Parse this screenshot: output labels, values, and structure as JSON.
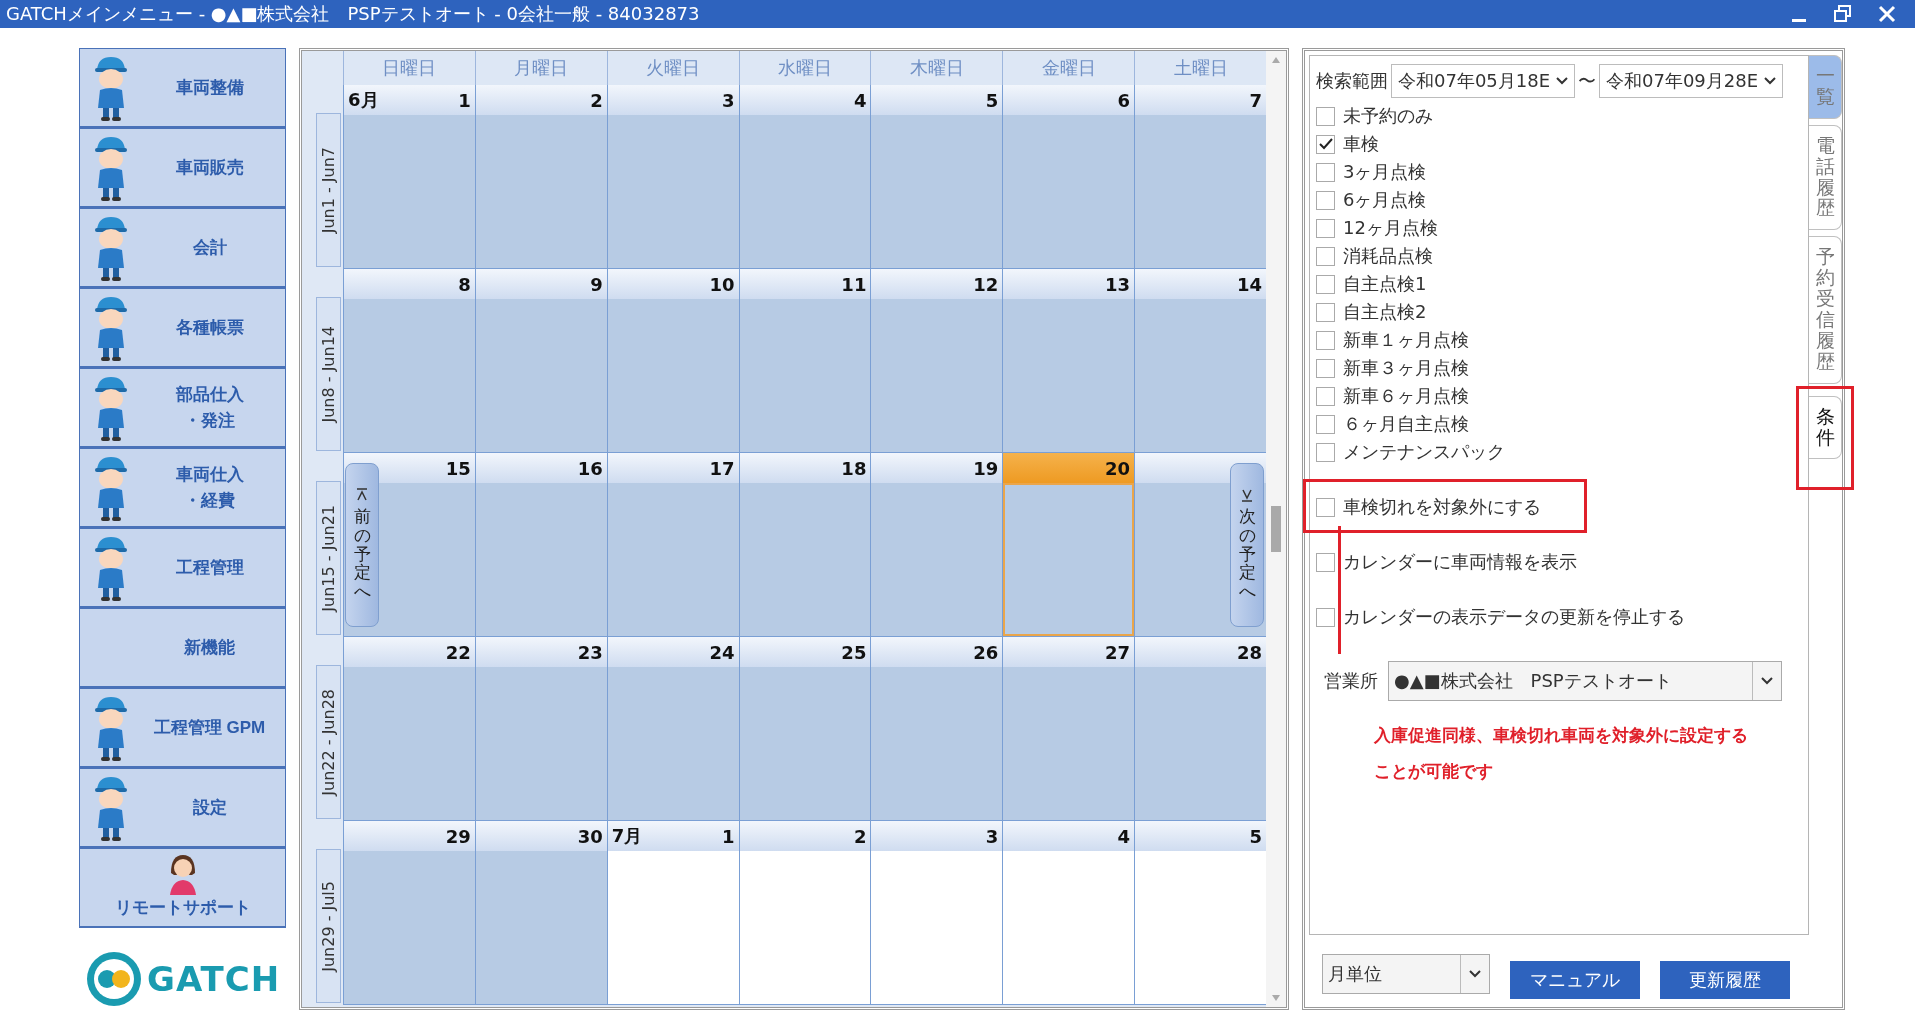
{
  "window": {
    "title": "GATCHメインメニュー - ●▲■株式会社　PSPテストオート - 0会社一般 - 84032873"
  },
  "sidebar": {
    "items": [
      {
        "lines": [
          "車両整備"
        ],
        "kind": "mechanic"
      },
      {
        "lines": [
          "車両販売"
        ],
        "kind": "mechanic"
      },
      {
        "lines": [
          "会計"
        ],
        "kind": "mechanic"
      },
      {
        "lines": [
          "各種帳票"
        ],
        "kind": "mechanic"
      },
      {
        "lines": [
          "部品仕入",
          "・発注"
        ],
        "kind": "mechanic"
      },
      {
        "lines": [
          "車両仕入",
          "・経費"
        ],
        "kind": "mechanic"
      },
      {
        "lines": [
          "工程管理"
        ],
        "kind": "mechanic"
      },
      {
        "lines": [
          "新機能"
        ],
        "kind": "plain"
      },
      {
        "lines": [
          "工程管理 GPM"
        ],
        "kind": "mechanic"
      },
      {
        "lines": [
          "設定"
        ],
        "kind": "mechanic"
      },
      {
        "lines": [
          "リモートサポート"
        ],
        "kind": "support"
      }
    ],
    "logo": "GATCH"
  },
  "calendar": {
    "weekdays": [
      "日曜日",
      "月曜日",
      "火曜日",
      "水曜日",
      "木曜日",
      "金曜日",
      "土曜日"
    ],
    "weeks": [
      {
        "label": "Jun1 - Jun7",
        "days": [
          {
            "day": "1",
            "month": "6月",
            "in_month": true,
            "today": false
          },
          {
            "day": "2",
            "in_month": true,
            "today": false
          },
          {
            "day": "3",
            "in_month": true,
            "today": false
          },
          {
            "day": "4",
            "in_month": true,
            "today": false
          },
          {
            "day": "5",
            "in_month": true,
            "today": false
          },
          {
            "day": "6",
            "in_month": true,
            "today": false
          },
          {
            "day": "7",
            "in_month": true,
            "today": false
          }
        ]
      },
      {
        "label": "Jun8 - Jun14",
        "days": [
          {
            "day": "8",
            "in_month": true,
            "today": false
          },
          {
            "day": "9",
            "in_month": true,
            "today": false
          },
          {
            "day": "10",
            "in_month": true,
            "today": false
          },
          {
            "day": "11",
            "in_month": true,
            "today": false
          },
          {
            "day": "12",
            "in_month": true,
            "today": false
          },
          {
            "day": "13",
            "in_month": true,
            "today": false
          },
          {
            "day": "14",
            "in_month": true,
            "today": false
          }
        ]
      },
      {
        "label": "Jun15 - Jun21",
        "prev_button": "前の予定へ",
        "next_button": "次の予定へ",
        "days": [
          {
            "day": "15",
            "in_month": true,
            "today": false
          },
          {
            "day": "16",
            "in_month": true,
            "today": false
          },
          {
            "day": "17",
            "in_month": true,
            "today": false
          },
          {
            "day": "18",
            "in_month": true,
            "today": false
          },
          {
            "day": "19",
            "in_month": true,
            "today": false
          },
          {
            "day": "20",
            "in_month": true,
            "today": true
          },
          {
            "in_month": true,
            "today": false
          }
        ]
      },
      {
        "label": "Jun22 - Jun28",
        "days": [
          {
            "day": "22",
            "in_month": true,
            "today": false
          },
          {
            "day": "23",
            "in_month": true,
            "today": false
          },
          {
            "day": "24",
            "in_month": true,
            "today": false
          },
          {
            "day": "25",
            "in_month": true,
            "today": false
          },
          {
            "day": "26",
            "in_month": true,
            "today": false
          },
          {
            "day": "27",
            "in_month": true,
            "today": false
          },
          {
            "day": "28",
            "in_month": true,
            "today": false
          }
        ]
      },
      {
        "label": "Jun29 - Jul5",
        "days": [
          {
            "day": "29",
            "in_month": true,
            "today": false
          },
          {
            "day": "30",
            "in_month": true,
            "today": false
          },
          {
            "day": "1",
            "month": "7月",
            "in_month": false,
            "today": false
          },
          {
            "day": "2",
            "in_month": false,
            "today": false
          },
          {
            "day": "3",
            "in_month": false,
            "today": false
          },
          {
            "day": "4",
            "in_month": false,
            "today": false
          },
          {
            "day": "5",
            "in_month": false,
            "today": false
          }
        ]
      }
    ]
  },
  "conditions": {
    "search": {
      "label": "検索範囲",
      "from": "令和07年05月18E",
      "separator": "〜",
      "to": "令和07年09月28E"
    },
    "filters": [
      {
        "label": "未予約のみ",
        "checked": false
      },
      {
        "label": "車検",
        "checked": true
      },
      {
        "label": "3ヶ月点検",
        "checked": false
      },
      {
        "label": "6ヶ月点検",
        "checked": false
      },
      {
        "label": "12ヶ月点検",
        "checked": false
      },
      {
        "label": "消耗品点検",
        "checked": false
      },
      {
        "label": "自主点検1",
        "checked": false
      },
      {
        "label": "自主点検2",
        "checked": false
      },
      {
        "label": "新車１ヶ月点検",
        "checked": false
      },
      {
        "label": "新車３ヶ月点検",
        "checked": false
      },
      {
        "label": "新車６ヶ月点検",
        "checked": false
      },
      {
        "label": "６ヶ月自主点検",
        "checked": false
      },
      {
        "label": "メンテナンスパック",
        "checked": false
      }
    ],
    "options": [
      {
        "label": "車検切れを対象外にする",
        "checked": false,
        "annotated": true
      },
      {
        "label": "カレンダーに車両情報を表示",
        "checked": false,
        "annotated": false
      },
      {
        "label": "カレンダーの表示データの更新を停止する",
        "checked": false,
        "annotated": false
      }
    ],
    "office": {
      "label": "営業所",
      "value": "●▲■株式会社　PSPテストオート"
    },
    "annotation": "入庫促進同様、車検切れ車両を対象外に設定することが可能です"
  },
  "period": {
    "value": "月単位"
  },
  "buttons": [
    "マニュアル",
    "更新履歴"
  ],
  "tabs": [
    {
      "label": "一覧",
      "selected": false,
      "hover": true,
      "annotated": false
    },
    {
      "label": "電話履歴",
      "selected": false,
      "hover": false,
      "annotated": false
    },
    {
      "label": "予約受信履歴",
      "selected": false,
      "hover": false,
      "annotated": false
    },
    {
      "label": "条件",
      "selected": true,
      "hover": false,
      "annotated": true
    }
  ]
}
